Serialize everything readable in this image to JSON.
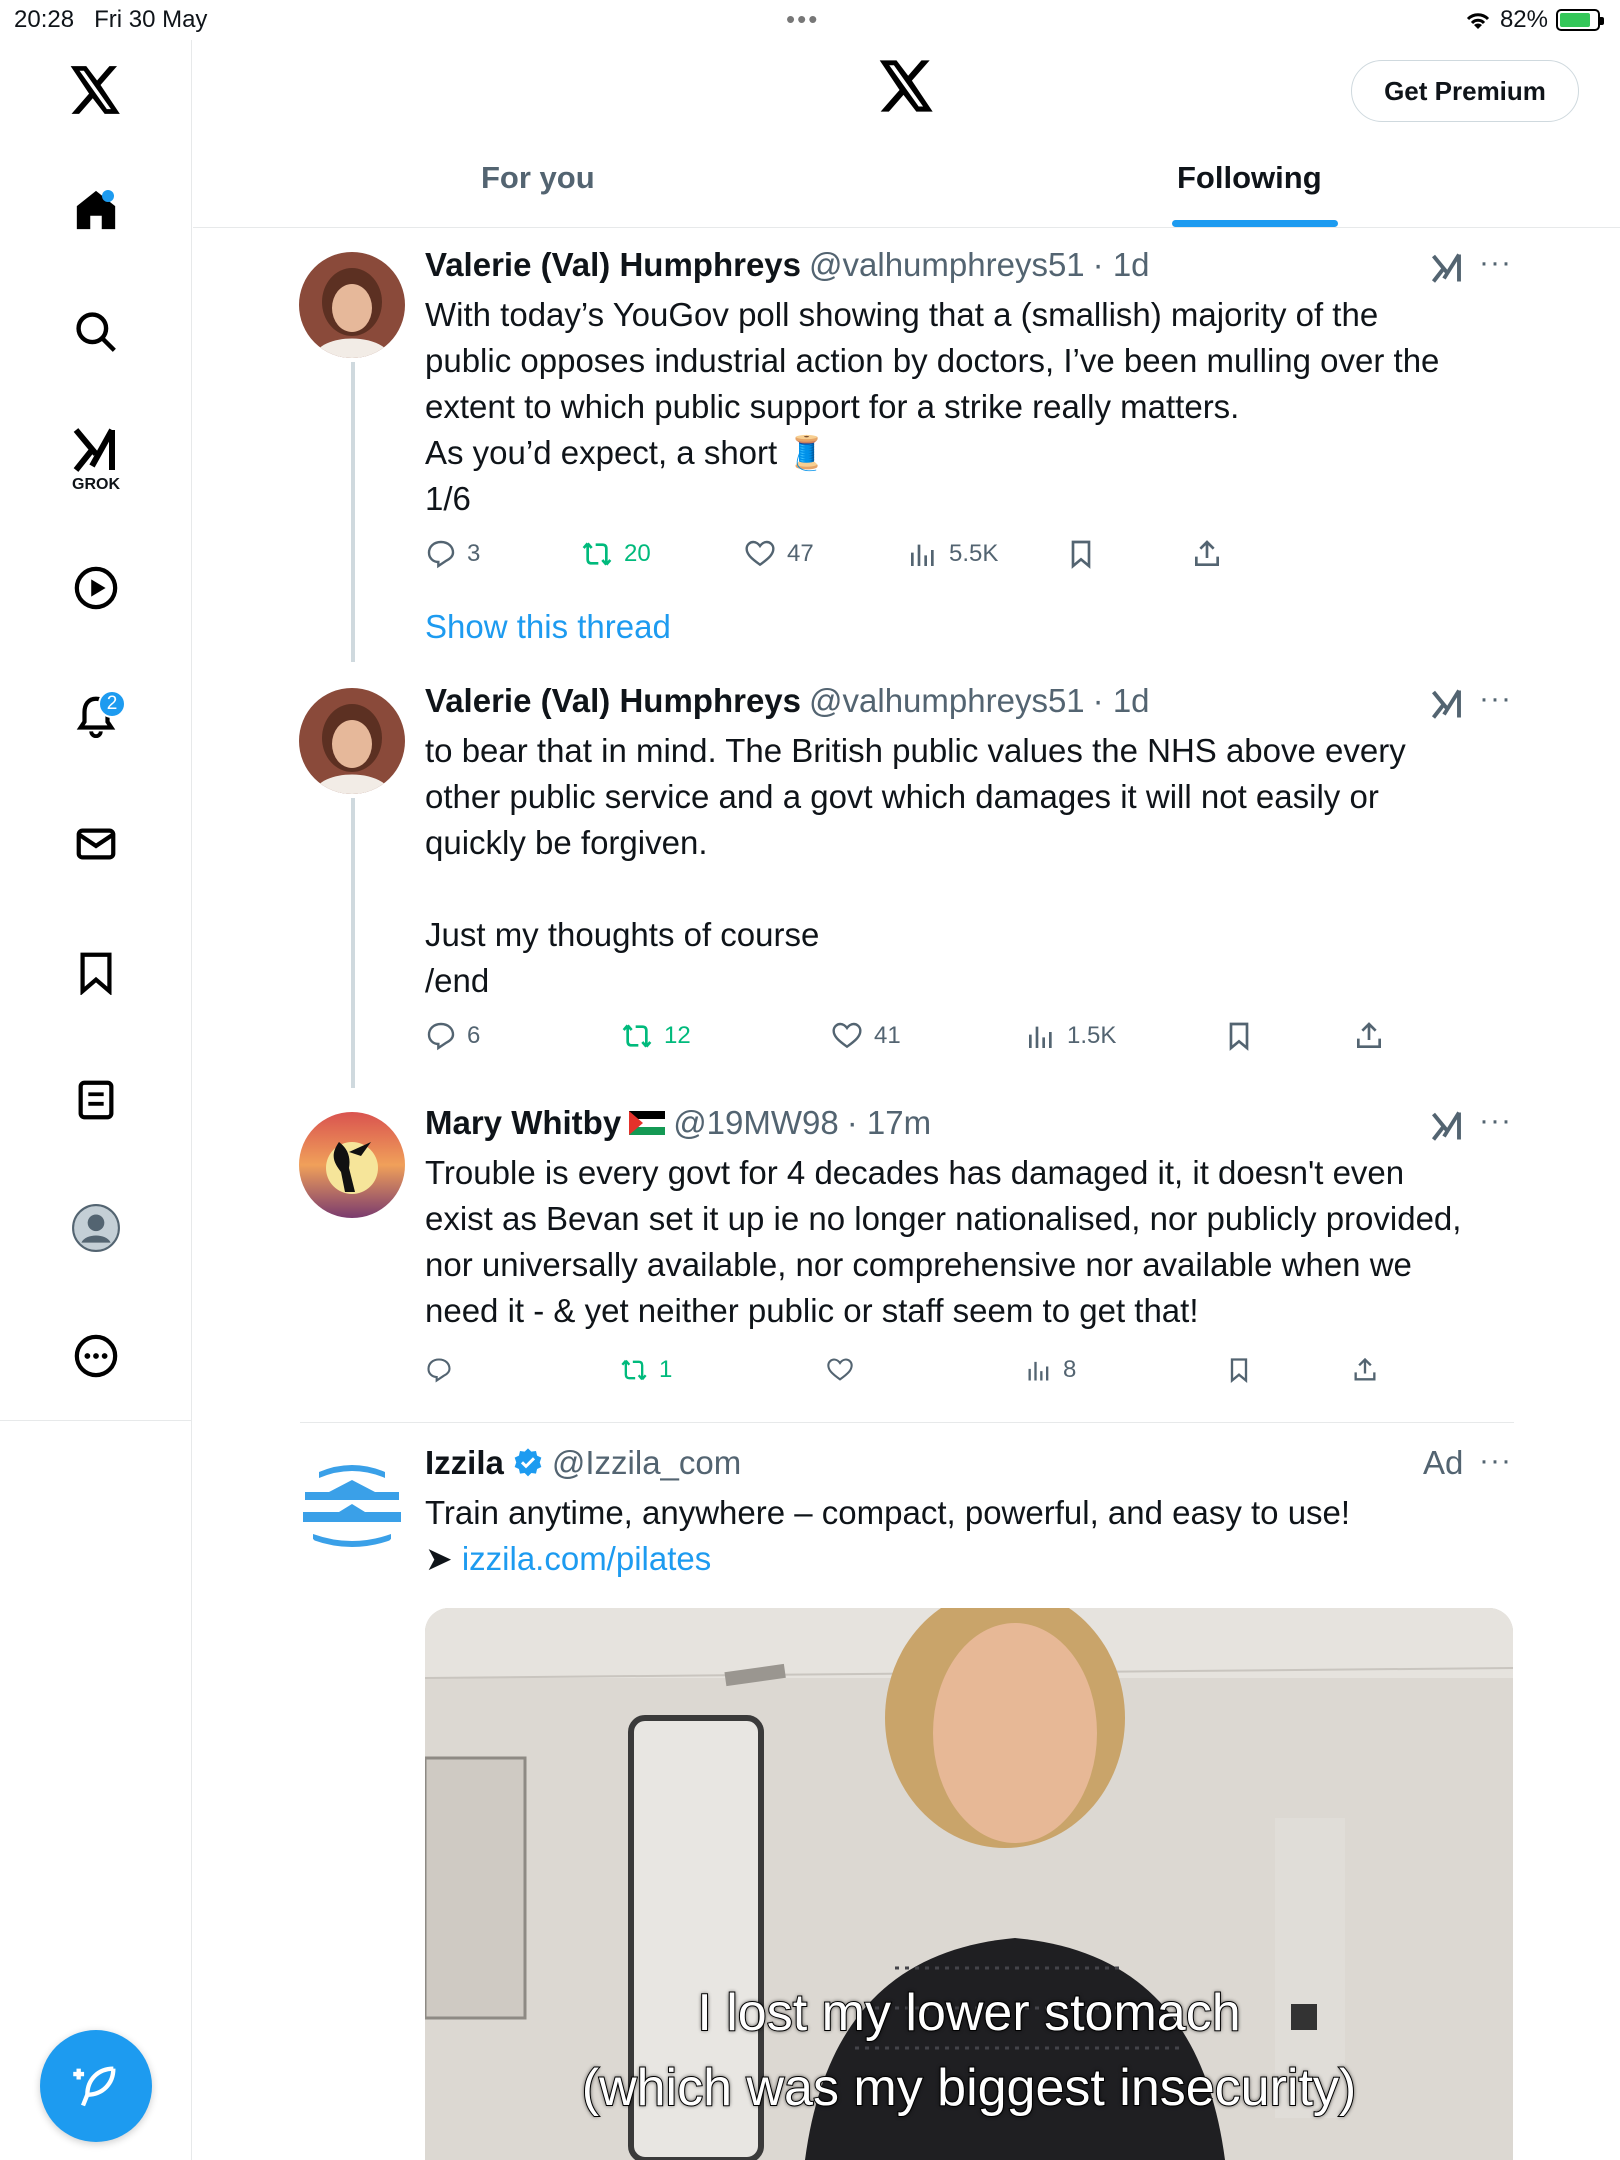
{
  "status_bar": {
    "time": "20:28",
    "date": "Fri 30 May",
    "battery": "82%",
    "battery_level": 0.82
  },
  "sidebar": {
    "grok_label": "GROK",
    "notifications_badge": "2"
  },
  "header": {
    "premium_button": "Get Premium",
    "tabs": [
      {
        "label": "For you",
        "active": false
      },
      {
        "label": "Following",
        "active": true
      }
    ]
  },
  "tweets": [
    {
      "name": "Valerie (Val) Humphreys",
      "handle": "@valhumphreys51",
      "time": "· 1d",
      "body": [
        "With today’s YouGov poll showing that a (smallish) majority of the",
        "public opposes industrial action by doctors, I’ve been mulling over the",
        "extent to which public support for a strike really matters.",
        "As you’d expect, a short 🧵",
        "1/6"
      ],
      "replies": "3",
      "reposts": "20",
      "likes": "47",
      "views": "5.5K",
      "show_thread": "Show this thread"
    },
    {
      "name": "Valerie (Val) Humphreys",
      "handle": "@valhumphreys51",
      "time": "· 1d",
      "body": [
        "to bear that in mind. The British public values the NHS above every",
        "other public service and a govt which damages it will not easily or",
        "quickly be forgiven.",
        "",
        "Just my thoughts of course",
        "/end"
      ],
      "replies": "6",
      "reposts": "12",
      "likes": "41",
      "views": "1.5K"
    },
    {
      "name": "Mary Whitby",
      "handle": "@19MW98",
      "time": "· 17m",
      "body": [
        "Trouble is every govt for 4 decades has damaged it, it doesn't even",
        "exist as Bevan set it up ie no longer nationalised, nor publicly provided,",
        "nor universally available, nor comprehensive nor available when we",
        "need it - & yet neither public or staff seem to get that!"
      ],
      "replies": "",
      "reposts": "1",
      "likes": "",
      "views": "8"
    }
  ],
  "ad": {
    "name": "Izzila",
    "handle": "@Izzila_com",
    "label": "Ad",
    "body": "Train anytime, anywhere – compact, powerful, and easy to use!",
    "link_prefix": "➤",
    "link": "izzila.com/pilates",
    "caption_line1": "I lost my lower stomach",
    "caption_line2": "(which was my biggest insecurity)"
  },
  "colors": {
    "accent": "#1d9bf0",
    "repost": "#00ba7c",
    "secondary_text": "#536471",
    "border": "#e7e9ea"
  }
}
